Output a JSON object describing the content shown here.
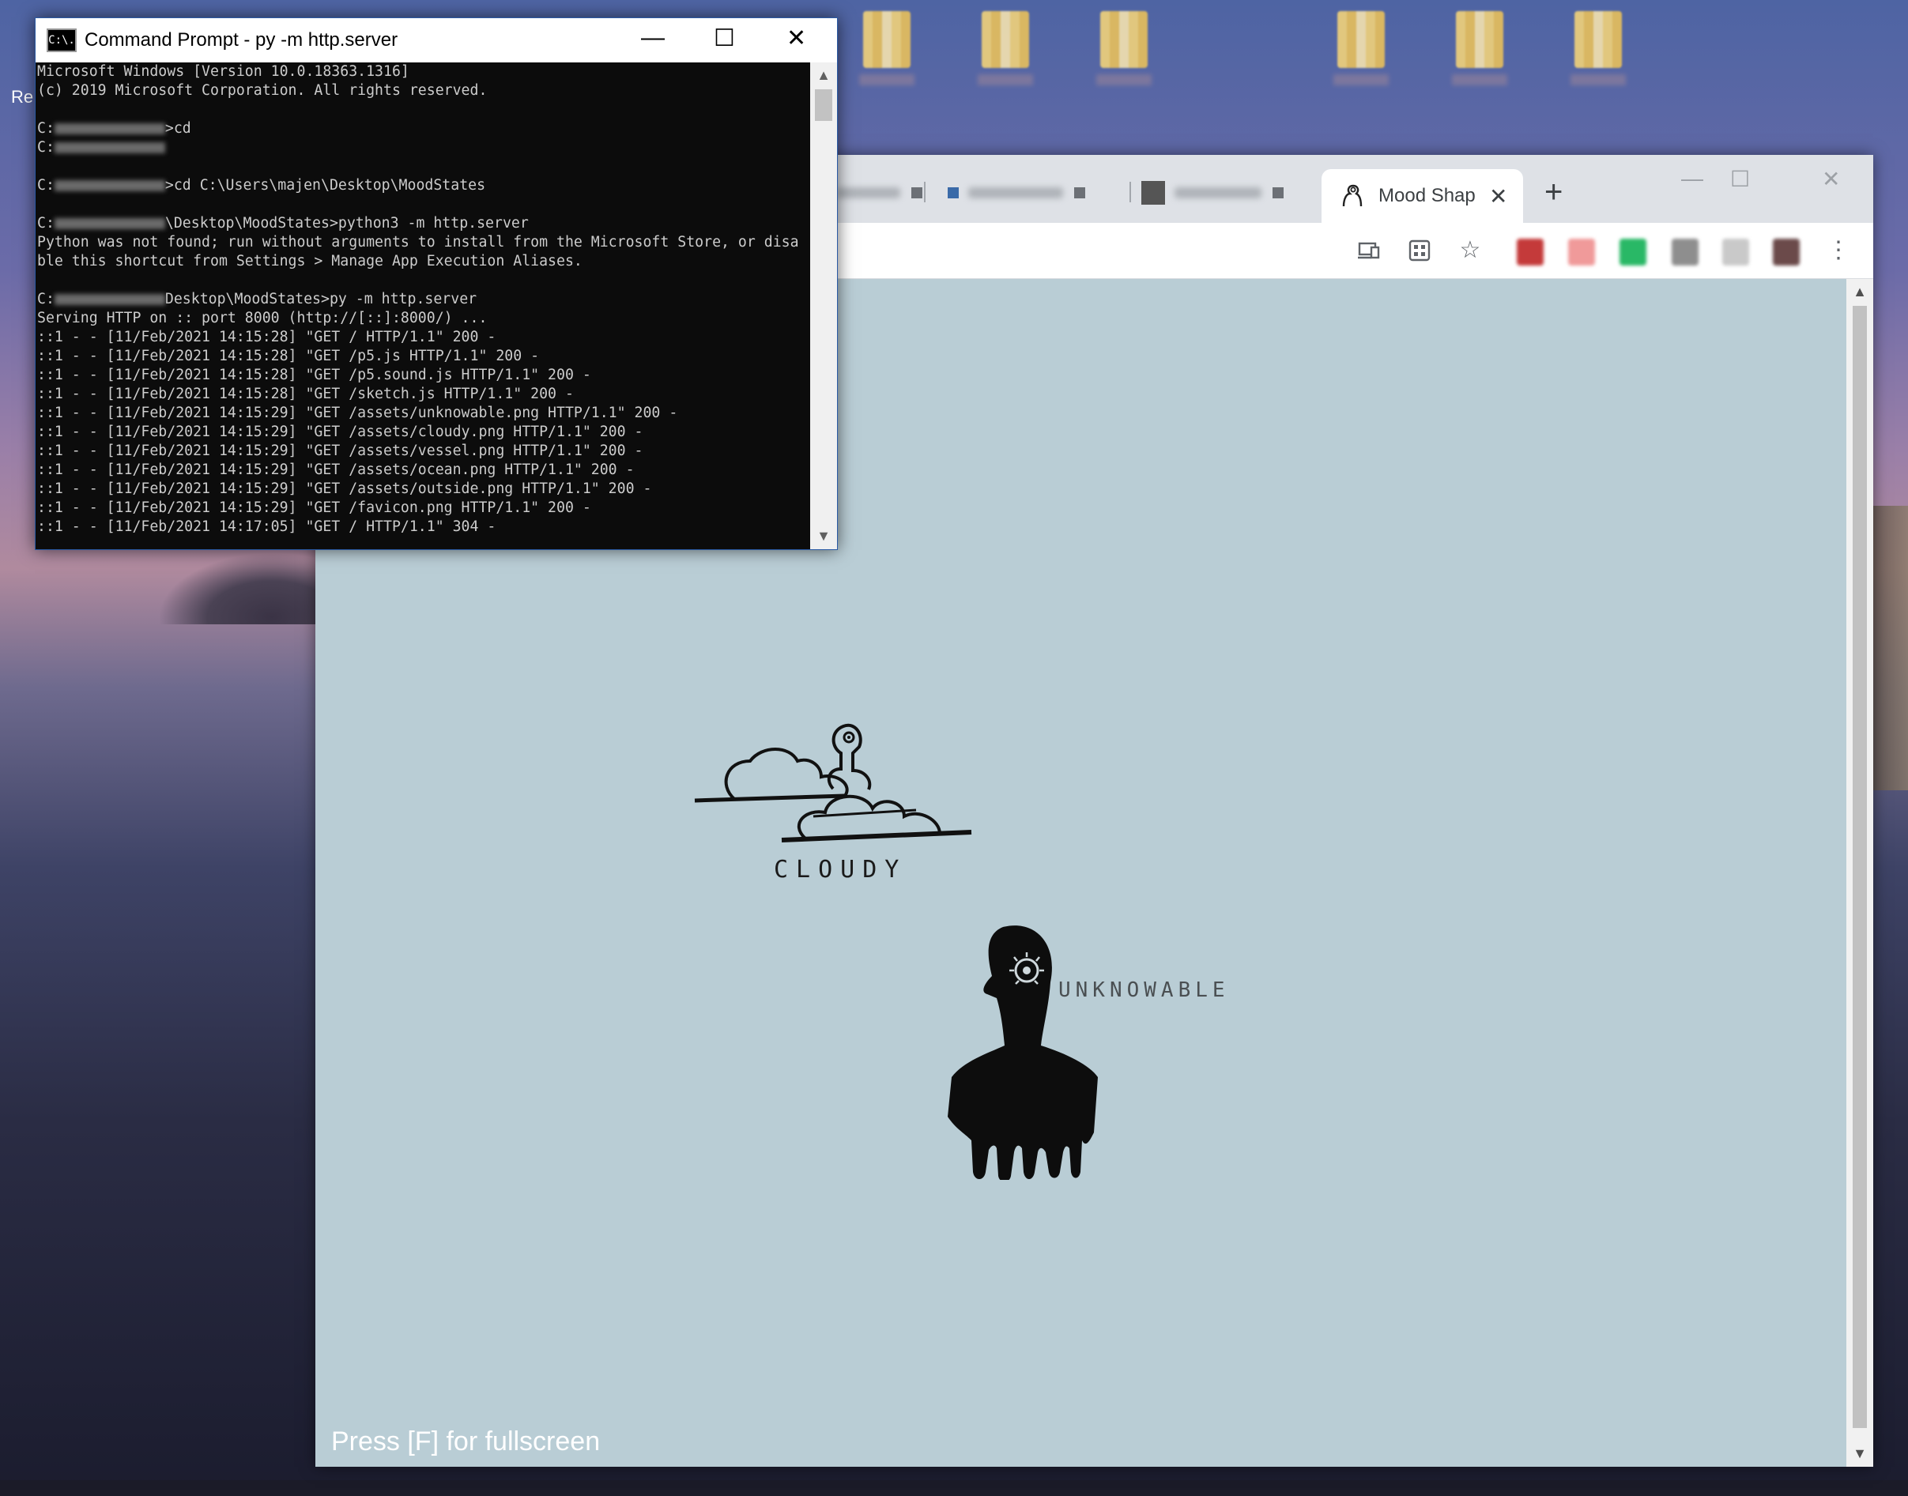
{
  "desktop": {
    "recycle_label": "Re"
  },
  "cmd": {
    "title": "Command Prompt - py  -m http.server",
    "icon_text": "C:\\.",
    "lines": [
      {
        "pre": "Microsoft Windows [Version 10.0.18363.1316]"
      },
      {
        "pre": "(c) 2019 Microsoft Corporation. All rights reserved."
      },
      {
        "pre": ""
      },
      {
        "pre": "C:",
        "redact": true,
        "post": ">cd"
      },
      {
        "pre": "C:",
        "redact": true,
        "post": ""
      },
      {
        "pre": ""
      },
      {
        "pre": "C:",
        "redact": true,
        "post": ">cd C:\\Users\\majen\\Desktop\\MoodStates"
      },
      {
        "pre": ""
      },
      {
        "pre": "C:",
        "redact": true,
        "post": "\\Desktop\\MoodStates>python3 -m http.server"
      },
      {
        "pre": "Python was not found; run without arguments to install from the Microsoft Store, or disa"
      },
      {
        "pre": "ble this shortcut from Settings > Manage App Execution Aliases."
      },
      {
        "pre": ""
      },
      {
        "pre": "C:",
        "redact": true,
        "post": "Desktop\\MoodStates>py -m http.server"
      },
      {
        "pre": "Serving HTTP on :: port 8000 (http://[::]:8000/) ..."
      },
      {
        "pre": "::1 - - [11/Feb/2021 14:15:28] \"GET / HTTP/1.1\" 200 -"
      },
      {
        "pre": "::1 - - [11/Feb/2021 14:15:28] \"GET /p5.js HTTP/1.1\" 200 -"
      },
      {
        "pre": "::1 - - [11/Feb/2021 14:15:28] \"GET /p5.sound.js HTTP/1.1\" 200 -"
      },
      {
        "pre": "::1 - - [11/Feb/2021 14:15:28] \"GET /sketch.js HTTP/1.1\" 200 -"
      },
      {
        "pre": "::1 - - [11/Feb/2021 14:15:29] \"GET /assets/unknowable.png HTTP/1.1\" 200 -"
      },
      {
        "pre": "::1 - - [11/Feb/2021 14:15:29] \"GET /assets/cloudy.png HTTP/1.1\" 200 -"
      },
      {
        "pre": "::1 - - [11/Feb/2021 14:15:29] \"GET /assets/vessel.png HTTP/1.1\" 200 -"
      },
      {
        "pre": "::1 - - [11/Feb/2021 14:15:29] \"GET /assets/ocean.png HTTP/1.1\" 200 -"
      },
      {
        "pre": "::1 - - [11/Feb/2021 14:15:29] \"GET /assets/outside.png HTTP/1.1\" 200 -"
      },
      {
        "pre": "::1 - - [11/Feb/2021 14:15:29] \"GET /favicon.png HTTP/1.1\" 200 -"
      },
      {
        "pre": "::1 - - [11/Feb/2021 14:17:05] \"GET / HTTP/1.1\" 304 -"
      }
    ]
  },
  "browser": {
    "active_tab_title": "Mood Shap",
    "close_glyph": "✕",
    "newtab_glyph": "+",
    "minimize_glyph": "—",
    "maximize_glyph": "☐",
    "window_close_glyph": "✕",
    "menu_glyph": "⋮",
    "star_glyph": "☆"
  },
  "page": {
    "label_cloudy": "CLOUDY",
    "label_unknowable": "UNKNOWABLE",
    "hint": "Press [F] for fullscreen"
  },
  "colors": {
    "page_bg": "#b9cdd5",
    "console_bg": "#0c0c0c",
    "console_fg": "#cccccc"
  }
}
